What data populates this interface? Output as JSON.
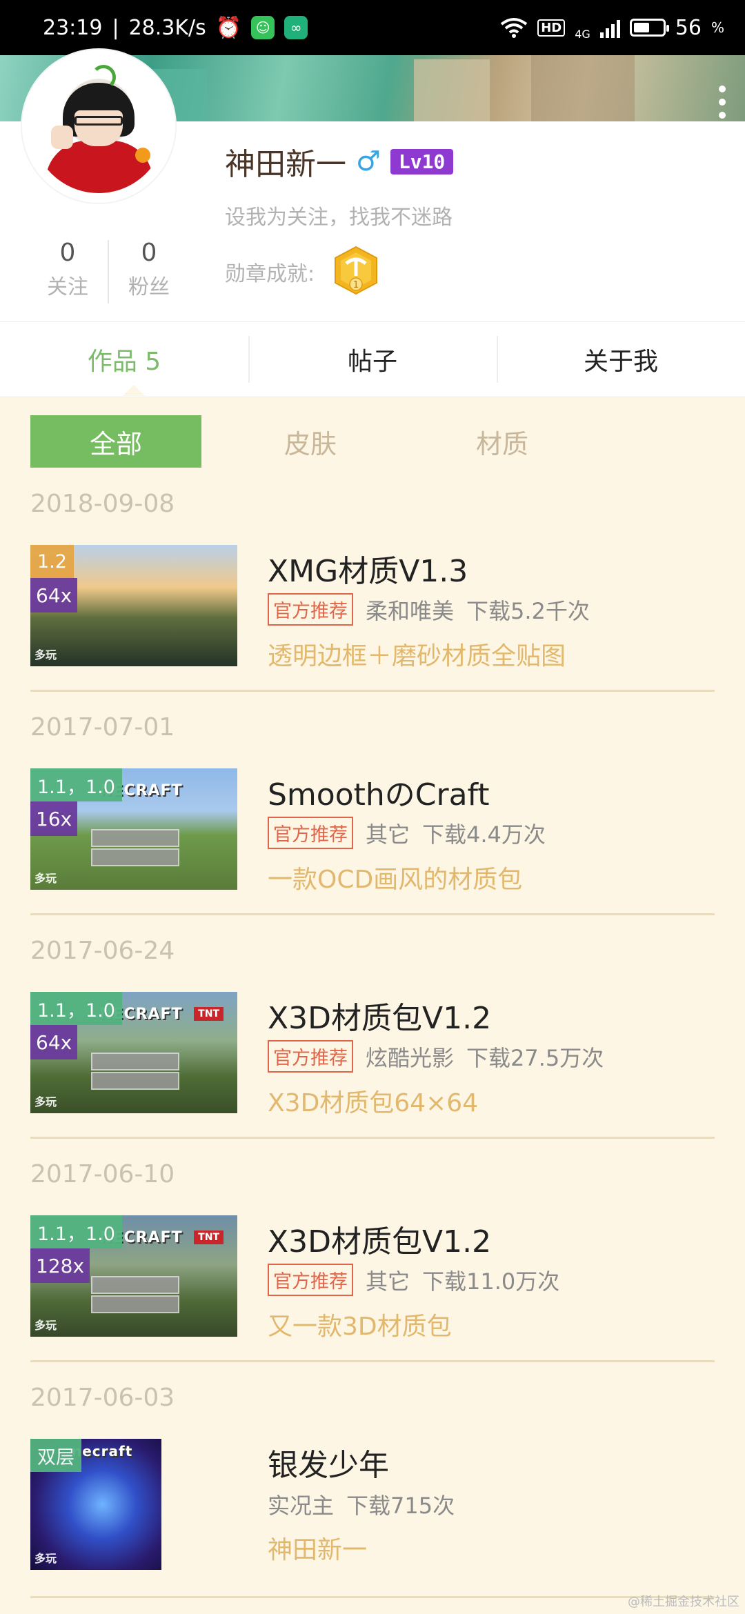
{
  "status_bar": {
    "time": "23:19",
    "speed": "28.3K/s",
    "alarm_icon": "⏰",
    "app1_icon": "☺",
    "app2_icon": "∞",
    "hd": "HD",
    "network": "4G",
    "battery": "56",
    "battery_unit": "%",
    "battery_level": 0.56
  },
  "profile": {
    "username": "神田新一",
    "gender_symbol": "♂",
    "level": "Lv10",
    "signature": "设我为关注，找我不迷路",
    "medal_label": "勋章成就:",
    "medal_number": "1",
    "following_count": "0",
    "following_label": "关注",
    "fans_count": "0",
    "fans_label": "粉丝"
  },
  "tabs": [
    {
      "label": "作品 5"
    },
    {
      "label": "帖子"
    },
    {
      "label": "关于我"
    }
  ],
  "filters": [
    {
      "label": "全部"
    },
    {
      "label": "皮肤"
    },
    {
      "label": "材质"
    }
  ],
  "works": [
    {
      "date": "2018-09-08",
      "version": "1.2",
      "resolution": "64x",
      "title": "XMG材质V1.3",
      "badge": "官方推荐",
      "category": "柔和唯美",
      "downloads": "下载5.2千次",
      "description": "透明边框＋磨砂材质全贴图"
    },
    {
      "date": "2017-07-01",
      "version": "1.1，1.0",
      "resolution": "16x",
      "title": "SmoothのCraft",
      "badge": "官方推荐",
      "category": "其它",
      "downloads": "下载4.4万次",
      "description": "一款OCD画风的材质包",
      "thumb_logo": "NECRAFT"
    },
    {
      "date": "2017-06-24",
      "version": "1.1，1.0",
      "resolution": "64x",
      "title": "X3D材质包V1.2",
      "badge": "官方推荐",
      "category": "炫酷光影",
      "downloads": "下载27.5万次",
      "description": "X3D材质包64×64",
      "thumb_logo": "NECRAFT",
      "thumb_tnt": "TNT"
    },
    {
      "date": "2017-06-10",
      "version": "1.1，1.0",
      "resolution": "128x",
      "title": "X3D材质包V1.2",
      "badge": "官方推荐",
      "category": "其它",
      "downloads": "下载11.0万次",
      "description": "又一款3D材质包",
      "thumb_logo": "NECRAFT",
      "thumb_tnt": "TNT"
    },
    {
      "date": "2017-06-03",
      "version": "双层",
      "title": "银发少年",
      "category": "实况主",
      "downloads": "下载715次",
      "description": "神田新一",
      "thumb_logo": "necraft"
    }
  ],
  "watermark": "@稀土掘金技术社区",
  "colors": {
    "accent_green": "#76bd62",
    "official_red": "#e0654a",
    "desc_gold": "#e1b86d",
    "level_purple": "#8e3ad0",
    "background": "#fdf6e4"
  }
}
